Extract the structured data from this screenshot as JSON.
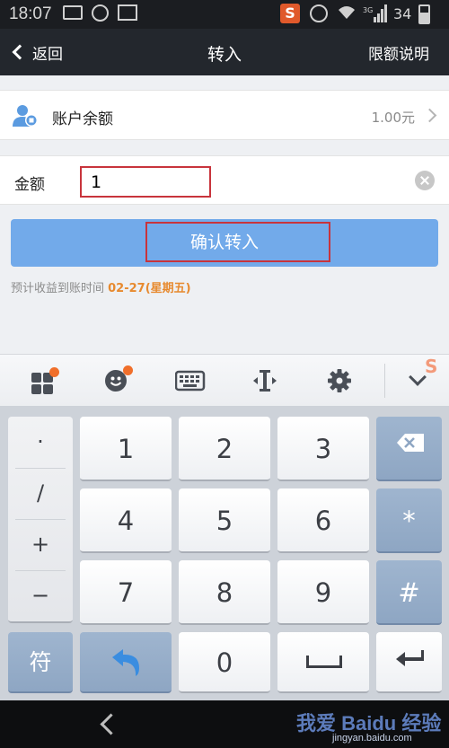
{
  "status_bar": {
    "time": "18:07",
    "battery": "34",
    "app_badge": "S"
  },
  "header": {
    "back_label": "返回",
    "title": "转入",
    "limit_link": "限额说明"
  },
  "balance": {
    "label": "账户余额",
    "value": "1.00元"
  },
  "amount": {
    "label": "金额",
    "value": "1"
  },
  "confirm": {
    "label": "确认转入"
  },
  "eta": {
    "prefix": "预计收益到账时间 ",
    "date": "02-27(星期五)"
  },
  "keyboard": {
    "brand_mark": "S",
    "symbols": [
      "·",
      "/",
      "+",
      "−"
    ],
    "digits": [
      "1",
      "2",
      "3",
      "4",
      "5",
      "6",
      "7",
      "8",
      "9",
      "0"
    ],
    "star": "*",
    "hash": "#",
    "symbol_key": "符"
  },
  "watermark": {
    "text": "我爱 Baidu 经验",
    "url": "jingyan.baidu.com"
  },
  "colors": {
    "title_bar": "#23272d",
    "confirm_button": "#72aaea",
    "highlight_box": "#c8343c",
    "eta_date": "#e78a2f",
    "badge": "#f06f2b"
  }
}
